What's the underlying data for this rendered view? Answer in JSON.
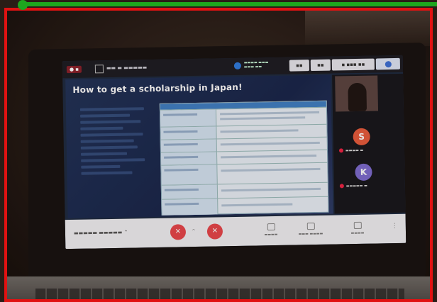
{
  "slide": {
    "title": "How to get a scholarship in Japan!"
  },
  "colors": {
    "frame_green": "#1ea61e",
    "frame_red": "#e01212",
    "mic_button": "#e8454a",
    "avatar_s": "#e85b3c",
    "avatar_k": "#7b6ad0",
    "table_header": "#3e7fc4"
  },
  "participants": [
    {
      "initial": "S"
    },
    {
      "initial": "K"
    }
  ],
  "icons": {
    "mic": "mic-off-icon",
    "camera": "camera-off-icon",
    "more": "more-options-icon"
  }
}
